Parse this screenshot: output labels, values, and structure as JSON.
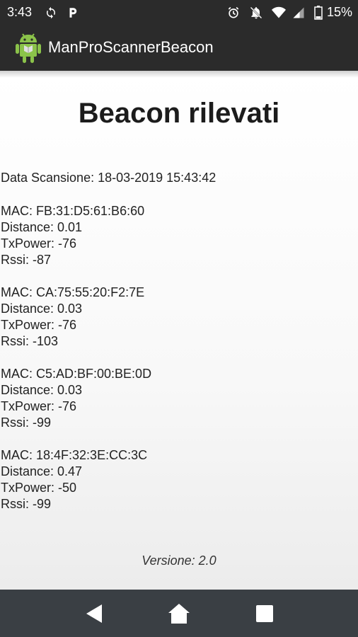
{
  "status_bar": {
    "time": "3:43",
    "battery_percent": "15%",
    "icons": [
      "sync-icon",
      "parking-icon",
      "alarm-icon",
      "notifications-off-icon",
      "wifi-icon",
      "signal-icon",
      "battery-icon"
    ]
  },
  "app_bar": {
    "title": "ManProScannerBeacon",
    "icon": "android-icon"
  },
  "main": {
    "title": "Beacon rilevati",
    "scan_date": "Data Scansione: 18-03-2019 15:43:42",
    "beacons": [
      {
        "mac": "MAC: FB:31:D5:61:B6:60",
        "distance": "Distance: 0.01",
        "txpower": "TxPower: -76",
        "rssi": "Rssi: -87"
      },
      {
        "mac": "MAC: CA:75:55:20:F2:7E",
        "distance": "Distance: 0.03",
        "txpower": "TxPower: -76",
        "rssi": "Rssi: -103"
      },
      {
        "mac": "MAC: C5:AD:BF:00:BE:0D",
        "distance": "Distance: 0.03",
        "txpower": "TxPower: -76",
        "rssi": "Rssi: -99"
      },
      {
        "mac": "MAC: 18:4F:32:3E:CC:3C",
        "distance": "Distance: 0.47",
        "txpower": "TxPower: -50",
        "rssi": "Rssi: -99"
      }
    ],
    "version": "Versione: 2.0"
  },
  "nav_bar": {
    "buttons": [
      "back-icon",
      "home-icon",
      "recents-icon"
    ]
  },
  "colors": {
    "bar": "#2b2b2b",
    "nav": "#3a3f44",
    "android_green": "#8bc34a"
  }
}
